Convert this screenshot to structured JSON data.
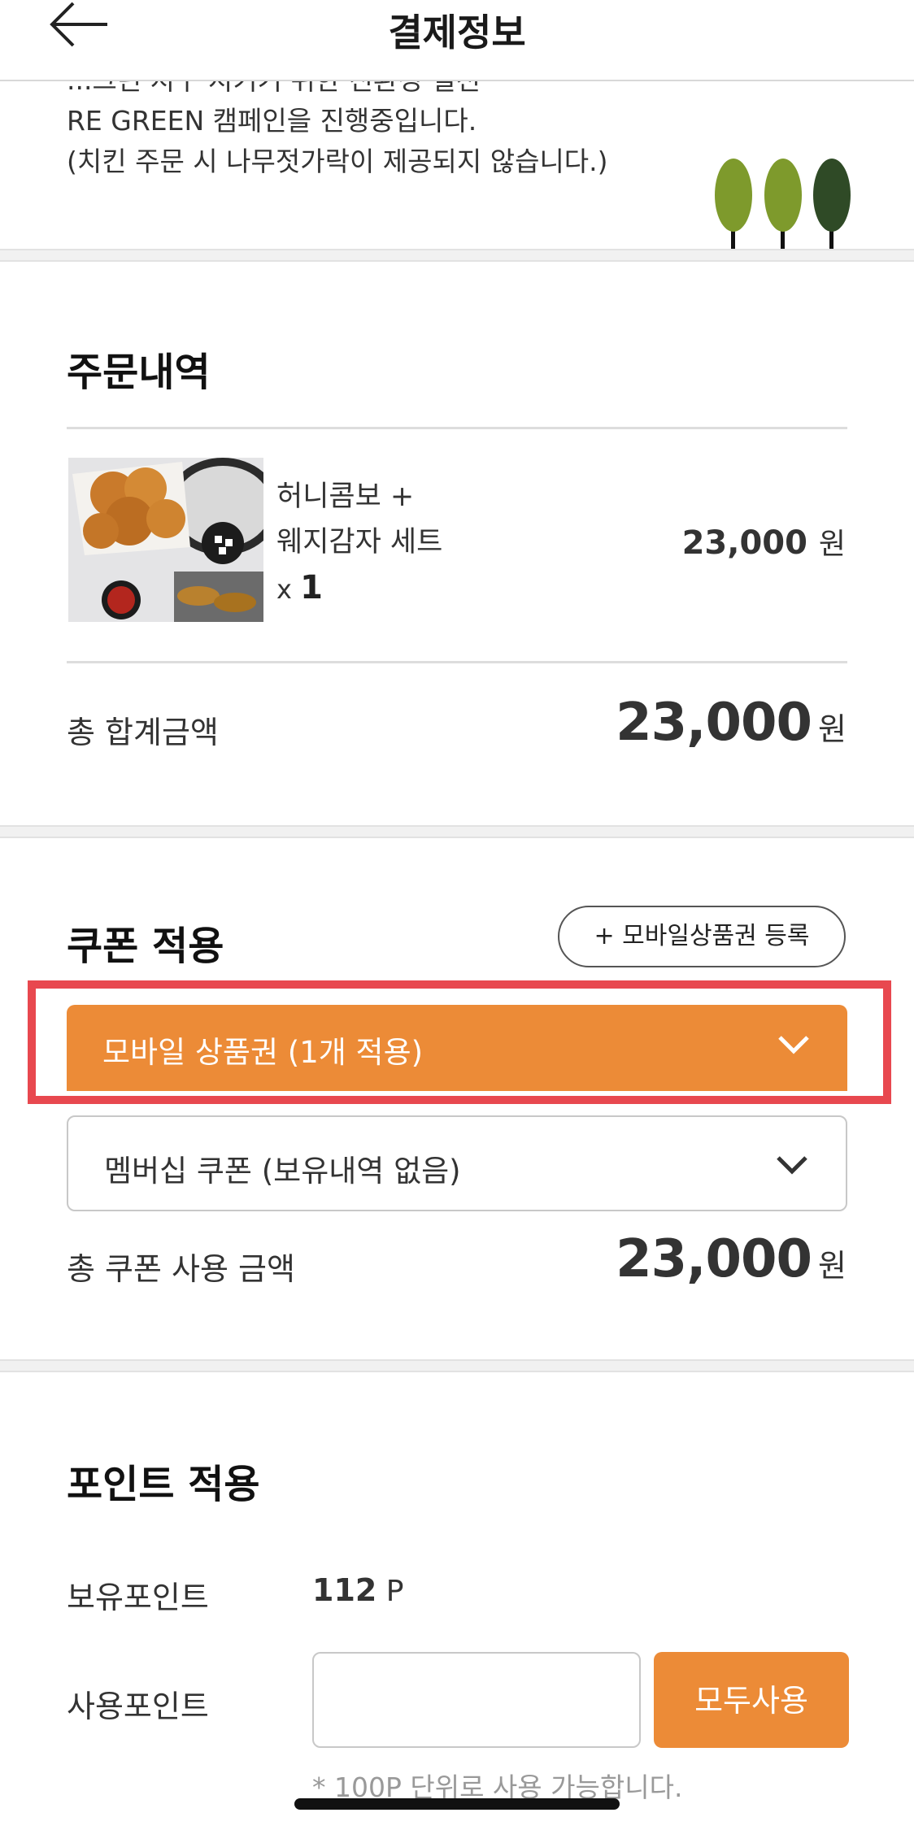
{
  "header": {
    "title": "결제정보",
    "back_icon": "arrow-left-icon"
  },
  "notice": {
    "line1_partial": "...그린 지구 지키기 위한 친환경 실천",
    "line2": "RE GREEN 캠페인을 진행중입니다.",
    "line3": "(치킨 주문 시 나무젓가락이 제공되지 않습니다.)",
    "trees_icon": "trees-icon",
    "tree_colors": [
      "#7e9a2c",
      "#7e9a2c",
      "#2f4a26"
    ]
  },
  "order": {
    "title": "주문내역",
    "item": {
      "name_line1": "허니콤보 +",
      "name_line2": "웨지감자 세트",
      "qty_prefix": "x",
      "qty": "1",
      "price": "23,000",
      "currency": "원"
    },
    "total_label": "총 합계금액",
    "total_amount": "23,000",
    "total_currency": "원"
  },
  "coupon": {
    "title": "쿠폰 적용",
    "register_button": "+ 모바일상품권 등록",
    "mobile_voucher_dropdown": "모바일 상품권 (1개 적용)",
    "membership_dropdown": "멤버십 쿠폰 (보유내역 없음)",
    "total_label": "총 쿠폰 사용 금액",
    "total_amount": "23,000",
    "total_currency": "원"
  },
  "points": {
    "title": "포인트 적용",
    "owned_label": "보유포인트",
    "owned_value": "112",
    "owned_unit": "P",
    "use_label": "사용포인트",
    "input_value": "",
    "use_all_button": "모두사용",
    "hint": "* 100P 단위로 사용 가능합니다."
  },
  "colors": {
    "accent": "#ec8b37",
    "highlight": "#e8484f",
    "text": "#333333",
    "hint": "#999999"
  }
}
